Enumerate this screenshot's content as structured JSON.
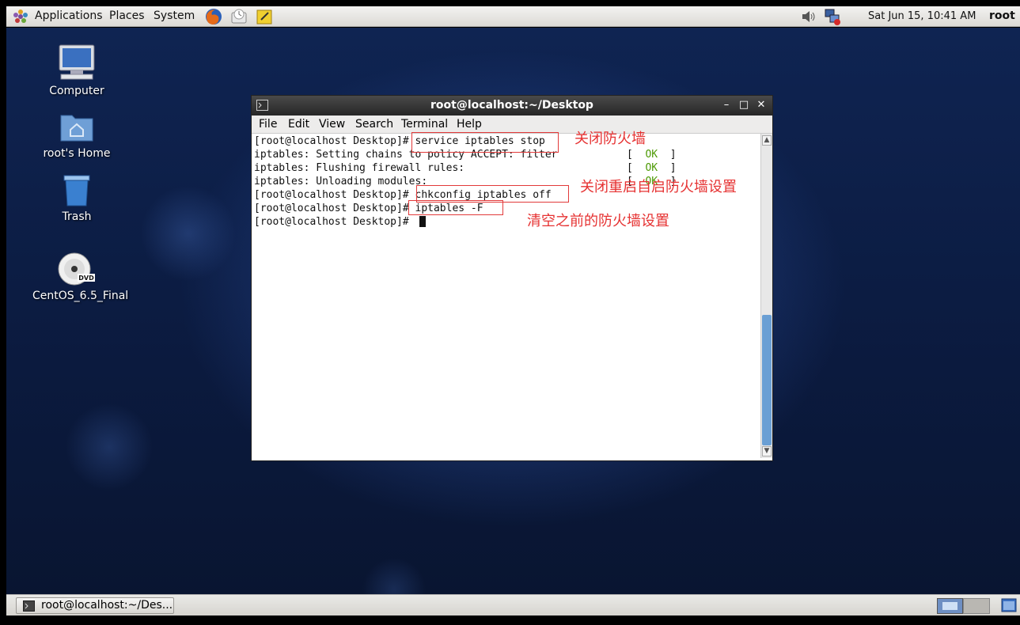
{
  "top_panel": {
    "menus": [
      "Applications",
      "Places",
      "System"
    ],
    "clock": "Sat Jun 15, 10:41 AM",
    "user": "root"
  },
  "desktop": {
    "icons": [
      {
        "label": "Computer"
      },
      {
        "label": "root's Home"
      },
      {
        "label": "Trash"
      },
      {
        "label": "CentOS_6.5_Final",
        "badge": "DVD"
      }
    ]
  },
  "terminal": {
    "title": "root@localhost:~/Desktop",
    "menu": [
      "File",
      "Edit",
      "View",
      "Search",
      "Terminal",
      "Help"
    ],
    "lines": [
      "[root@localhost Desktop]# service iptables stop",
      "iptables: Setting chains to policy ACCEPT: filter",
      "iptables: Flushing firewall rules:",
      "iptables: Unloading modules:",
      "[root@localhost Desktop]# chkconfig iptables off",
      "[root@localhost Desktop]# iptables -F",
      "[root@localhost Desktop]# "
    ],
    "status": {
      "open": "[",
      "ok": "OK",
      "close": "]"
    },
    "annotations": [
      "关闭防火墙",
      "关闭重启自启防火墙设置",
      "清空之前的防火墙设置"
    ]
  },
  "bottom_panel": {
    "task_label": "root@localhost:~/Des..."
  },
  "colors": {
    "annotation": "#e63232",
    "ok": "#4e9a06",
    "desktop": "#0f2452"
  }
}
